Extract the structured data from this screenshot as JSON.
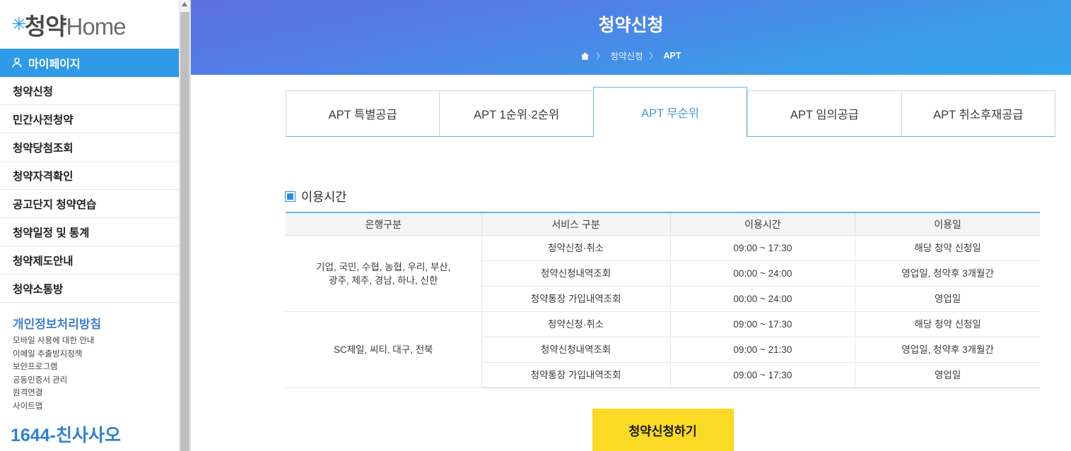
{
  "brand": {
    "logo_star": "✳",
    "logo_kr": "청약",
    "logo_en": "Home"
  },
  "sidebar": {
    "active_item": {
      "label": "마이페이지",
      "icon": "person-icon"
    },
    "items": [
      {
        "label": "청약신청"
      },
      {
        "label": "민간사전청약"
      },
      {
        "label": "청약당첨조회"
      },
      {
        "label": "청약자격확인"
      },
      {
        "label": "공고단지 청약연습"
      },
      {
        "label": "청약일정 및 통계"
      },
      {
        "label": "청약제도안내"
      },
      {
        "label": "청약소통방"
      }
    ],
    "policy_title": "개인정보처리방침",
    "sublinks": [
      {
        "label": "모바일 사용에 대한 안내"
      },
      {
        "label": "이메일 추출방지정책"
      },
      {
        "label": "보안프로그램"
      },
      {
        "label": "공동인증서 관리"
      },
      {
        "label": "원격연결"
      },
      {
        "label": "사이트맵"
      }
    ],
    "phone": "1644-친사사오"
  },
  "header": {
    "title": "청약신청",
    "breadcrumb": {
      "home_icon": "home-icon",
      "sep": "〉",
      "items": [
        {
          "label": "청약신청"
        },
        {
          "label": "APT"
        }
      ]
    },
    "gradient_from": "#5e6fe2",
    "gradient_to": "#32a5ec"
  },
  "tabs": [
    {
      "label": "APT 특별공급",
      "active": false
    },
    {
      "label": "APT 1순위·2순위",
      "active": false
    },
    {
      "label": "APT 무순위",
      "active": true
    },
    {
      "label": "APT 임의공급",
      "active": false
    },
    {
      "label": "APT 취소후재공급",
      "active": false
    }
  ],
  "section": {
    "icon": "square-bullet-icon",
    "title": "이용시간",
    "table": {
      "columns": [
        "은행구분",
        "서비스 구분",
        "이용시간",
        "이용일"
      ],
      "groups": [
        {
          "bank": "기업, 국민, 수협, 농협, 우리, 부산,\n광주, 제주, 경남, 하나, 신한",
          "rows": [
            {
              "service": "청약신청·취소",
              "time": "09:00 ~ 17:30",
              "day": "해당 청약 신청일"
            },
            {
              "service": "청약신청내역조회",
              "time": "00:00 ~ 24:00",
              "day": "영업일, 청약후 3개월간"
            },
            {
              "service": "청약통장 가입내역조회",
              "time": "00:00 ~ 24:00",
              "day": "영업일"
            }
          ]
        },
        {
          "bank": "SC제일, 씨티, 대구, 전북",
          "rows": [
            {
              "service": "청약신청·취소",
              "time": "09:00 ~ 17:30",
              "day": "해당 청약 신청일"
            },
            {
              "service": "청약신청내역조회",
              "time": "09:00 ~ 21:30",
              "day": "영업일, 청약후 3개월간"
            },
            {
              "service": "청약통장 가입내역조회",
              "time": "09:00 ~ 17:30",
              "day": "영업일"
            }
          ]
        }
      ]
    }
  },
  "apply_button": {
    "label": "청약신청하기",
    "color": "#fada24"
  }
}
